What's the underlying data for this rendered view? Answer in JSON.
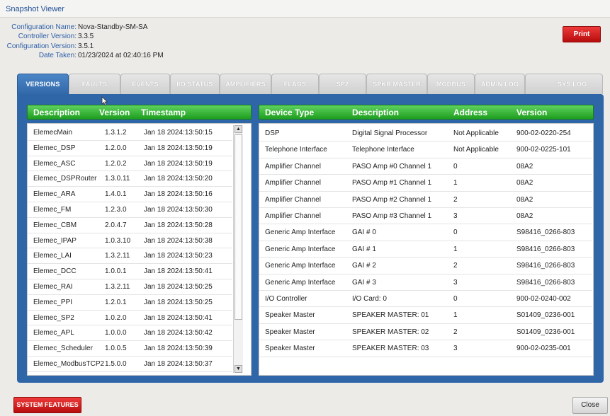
{
  "window": {
    "title": "Snapshot Viewer"
  },
  "info": [
    {
      "label": "Configuration Name:",
      "value": "Nova-Standby-SM-SA"
    },
    {
      "label": "Controller Version:",
      "value": "3.3.5"
    },
    {
      "label": "Configuration Version:",
      "value": "3.5.1"
    },
    {
      "label": "Date Taken:",
      "value": "01/23/2024 at 02:40:16 PM"
    }
  ],
  "buttons": {
    "print": "Print",
    "system_features": "SYSTEM FEATURES",
    "close": "Close"
  },
  "tabs": [
    "VERSIONS",
    "FAULTS",
    "EVENTS",
    "I/O STATUS",
    "AMPLIFIERS",
    "FLAGS",
    "SP2",
    "SPKR MASTER",
    "MODBUS",
    "ADMIN LOG",
    "SYS LOG"
  ],
  "active_tab": "VERSIONS",
  "versions_table": {
    "headers": [
      "Description",
      "Version",
      "Timestamp"
    ],
    "rows": [
      [
        "ElemecMain",
        "1.3.1.2",
        "Jan 18 2024:13:50:15"
      ],
      [
        "Elemec_DSP",
        "1.2.0.0",
        "Jan 18 2024:13:50:19"
      ],
      [
        "Elemec_ASC",
        "1.2.0.2",
        "Jan 18 2024:13:50:19"
      ],
      [
        "Elemec_DSPRouter",
        "1.3.0.11",
        "Jan 18 2024:13:50:20"
      ],
      [
        "Elemec_ARA",
        "1.4.0.1",
        "Jan 18 2024:13:50:16"
      ],
      [
        "Elemec_FM",
        "1.2.3.0",
        "Jan 18 2024:13:50:30"
      ],
      [
        "Elemec_CBM",
        "2.0.4.7",
        "Jan 18 2024:13:50:28"
      ],
      [
        "Elemec_IPAP",
        "1.0.3.10",
        "Jan 18 2024:13:50:38"
      ],
      [
        "Elemec_LAI",
        "1.3.2.11",
        "Jan 18 2024:13:50:23"
      ],
      [
        "Elemec_DCC",
        "1.0.0.1",
        "Jan 18 2024:13:50:41"
      ],
      [
        "Elemec_RAI",
        "1.3.2.11",
        "Jan 18 2024:13:50:25"
      ],
      [
        "Elemec_PPI",
        "1.2.0.1",
        "Jan 18 2024:13:50:25"
      ],
      [
        "Elemec_SP2",
        "1.0.2.0",
        "Jan 18 2024:13:50:41"
      ],
      [
        "Elemec_APL",
        "1.0.0.0",
        "Jan 18 2024:13:50:42"
      ],
      [
        "Elemec_Scheduler",
        "1.0.0.5",
        "Jan 18 2024:13:50:39"
      ],
      [
        "Elemec_ModbusTCP2",
        "1.5.0.0",
        "Jan 18 2024:13:50:37"
      ]
    ]
  },
  "devices_table": {
    "headers": [
      "Device Type",
      "Description",
      "Address",
      "Version"
    ],
    "rows": [
      [
        "DSP",
        "Digital Signal Processor",
        "Not Applicable",
        "900-02-0220-254"
      ],
      [
        "Telephone Interface",
        "Telephone Interface",
        "Not Applicable",
        "900-02-0225-101"
      ],
      [
        "Amplifier Channel",
        "PASO Amp #0 Channel 1",
        "0",
        "08A2"
      ],
      [
        "Amplifier Channel",
        "PASO Amp #1 Channel 1",
        "1",
        "08A2"
      ],
      [
        "Amplifier Channel",
        "PASO Amp #2 Channel 1",
        "2",
        "08A2"
      ],
      [
        "Amplifier Channel",
        "PASO Amp #3 Channel 1",
        "3",
        "08A2"
      ],
      [
        "Generic Amp Interface",
        "GAI # 0",
        "0",
        "S98416_0266-803"
      ],
      [
        "Generic Amp Interface",
        "GAI # 1",
        "1",
        "S98416_0266-803"
      ],
      [
        "Generic Amp Interface",
        "GAI # 2",
        "2",
        "S98416_0266-803"
      ],
      [
        "Generic Amp Interface",
        "GAI # 3",
        "3",
        "S98416_0266-803"
      ],
      [
        "I/O Controller",
        "I/O Card: 0",
        "0",
        "900-02-0240-002"
      ],
      [
        "Speaker Master",
        "SPEAKER MASTER: 01",
        "1",
        "S01409_0236-001"
      ],
      [
        "Speaker Master",
        "SPEAKER MASTER: 02",
        "2",
        "S01409_0236-001"
      ],
      [
        "Speaker Master",
        "SPEAKER MASTER: 03",
        "3",
        "900-02-0235-001"
      ]
    ]
  },
  "colors": {
    "accent_blue": "#2f66a8",
    "header_green": "#2eb52e",
    "button_red": "#d42020"
  },
  "icons": {
    "scroll_up": "arrow-up-icon",
    "scroll_down": "arrow-down-icon",
    "cursor": "mouse-pointer-icon"
  }
}
